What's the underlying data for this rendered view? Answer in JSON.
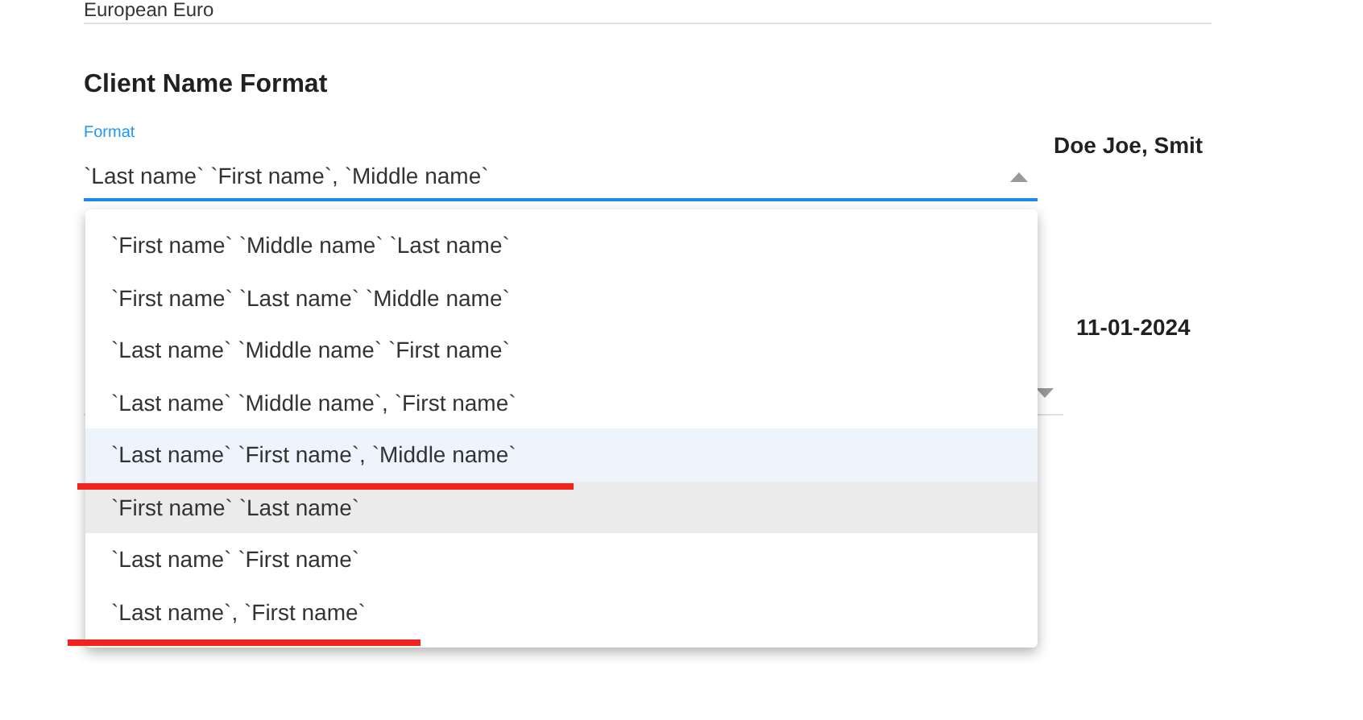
{
  "currency_field": {
    "value": "European Euro"
  },
  "client_name_format": {
    "heading": "Client Name Format",
    "label": "Format",
    "value": "`Last name` `First name`, `Middle name`",
    "preview": "Doe Joe, Smit",
    "expanded": true
  },
  "date_field": {
    "preview": "11-01-2024"
  },
  "format_menu": [
    {
      "label": "`First name` `Middle name` `Last name`",
      "selected": false,
      "hovered": false,
      "underlined": false
    },
    {
      "label": "`First name` `Last name` `Middle name`",
      "selected": false,
      "hovered": false,
      "underlined": false
    },
    {
      "label": "`Last name` `Middle name` `First name`",
      "selected": false,
      "hovered": false,
      "underlined": false
    },
    {
      "label": "`Last name` `Middle name`, `First name`",
      "selected": false,
      "hovered": false,
      "underlined": false
    },
    {
      "label": "`Last name` `First name`, `Middle name`",
      "selected": true,
      "hovered": false,
      "underlined": true
    },
    {
      "label": "`First name` `Last name`",
      "selected": false,
      "hovered": true,
      "underlined": false
    },
    {
      "label": "`Last name` `First name`",
      "selected": false,
      "hovered": false,
      "underlined": false
    },
    {
      "label": "`Last name`, `First name`",
      "selected": false,
      "hovered": false,
      "underlined": true
    }
  ]
}
